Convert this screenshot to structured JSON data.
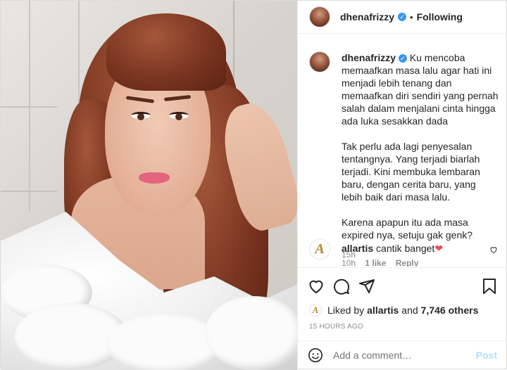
{
  "post": {
    "author": {
      "username": "dhenafrizzy",
      "verified_icon": "verified-badge-icon",
      "separator": "•",
      "follow_status": "Following"
    },
    "caption": {
      "username": "dhenafrizzy",
      "text": "Ku mencoba memaafkan masa lalu agar hati ini menjadi lebih tenang dan memaafkan diri sendiri yang pernah salah dalam menjalani cinta hingga ada luka sesakkan dada\n\nTak perlu ada lagi penyesalan tentangnya. Yang terjadi biarlah terjadi. Kini membuka lembaran baru, dengan cerita baru, yang lebih baik dari masa lalu.\n\nKarena apapun itu ada masa expired nya, setuju gak genk?",
      "time": "15h"
    },
    "comment": {
      "username": "allartis",
      "text": "cantik banget",
      "emoji": "❤",
      "time": "10h",
      "likes": "1 like",
      "reply": "Reply"
    },
    "likes": {
      "prefix": "Liked by",
      "user": "allartis",
      "conjunction": "and",
      "count": "7,746 others"
    },
    "timestamp": "15 HOURS AGO",
    "add_comment": {
      "placeholder": "Add a comment…",
      "post_label": "Post"
    }
  },
  "colors": {
    "verified": "#3897f0",
    "heart": "#ed4956",
    "post_disabled": "#b2dffc",
    "text_secondary": "#8e8e8e",
    "allartis_gold": "#b8872a"
  }
}
